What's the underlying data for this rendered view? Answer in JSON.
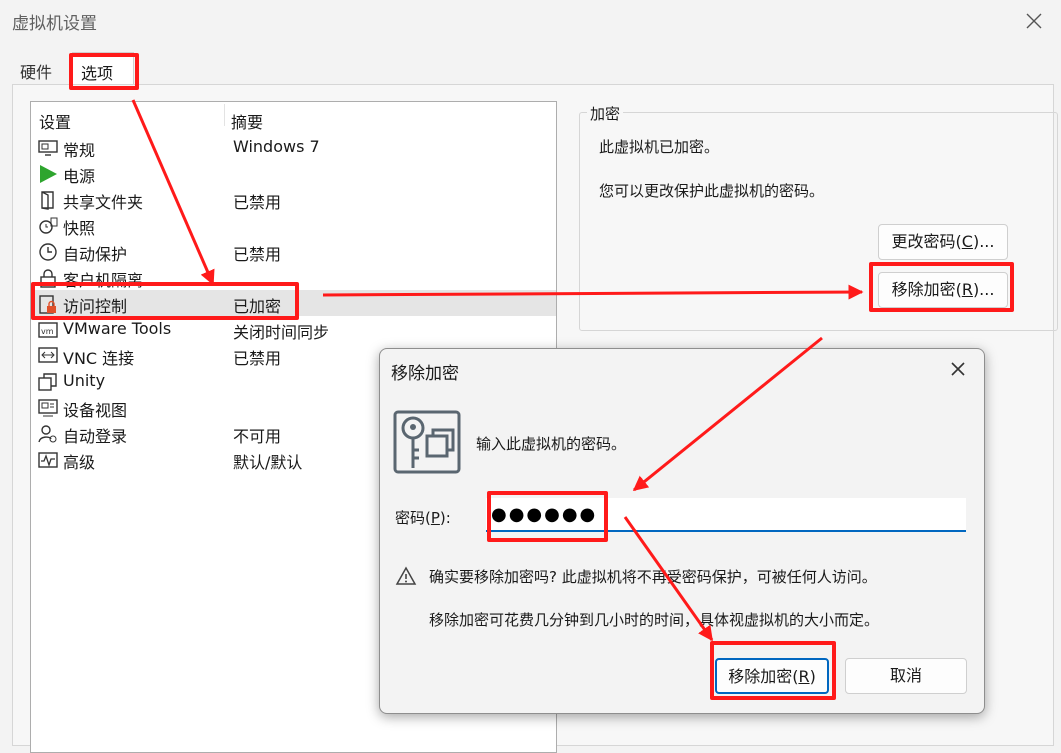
{
  "window": {
    "title": "虚拟机设置"
  },
  "tabs": {
    "hardware": "硬件",
    "options": "选项"
  },
  "list": {
    "header_setting": "设置",
    "header_summary": "摘要",
    "rows": [
      {
        "name": "常规",
        "summary": "Windows 7",
        "icon": "monitor-icon"
      },
      {
        "name": "电源",
        "summary": "",
        "icon": "power-play-icon"
      },
      {
        "name": "共享文件夹",
        "summary": "已禁用",
        "icon": "shared-folder-icon"
      },
      {
        "name": "快照",
        "summary": "",
        "icon": "snapshot-icon"
      },
      {
        "name": "自动保护",
        "summary": "已禁用",
        "icon": "clock-icon"
      },
      {
        "name": "客户机隔离",
        "summary": "",
        "icon": "lock-icon"
      },
      {
        "name": "访问控制",
        "summary": "已加密",
        "icon": "access-lock-icon"
      },
      {
        "name": "VMware Tools",
        "summary": "关闭时间同步",
        "icon": "vm-tools-icon"
      },
      {
        "name": "VNC 连接",
        "summary": "已禁用",
        "icon": "vnc-icon"
      },
      {
        "name": "Unity",
        "summary": "",
        "icon": "unity-icon"
      },
      {
        "name": "设备视图",
        "summary": "",
        "icon": "device-view-icon"
      },
      {
        "name": "自动登录",
        "summary": "不可用",
        "icon": "autologin-icon"
      },
      {
        "name": "高级",
        "summary": "默认/默认",
        "icon": "advanced-icon"
      }
    ]
  },
  "encryption": {
    "legend": "加密",
    "status": "此虚拟机已加密。",
    "hint": "您可以更改保护此虚拟机的密码。",
    "change_btn_pre": "更改密码(",
    "change_btn_key": "C",
    "change_btn_post": ")...",
    "remove_btn_pre": "移除加密(",
    "remove_btn_key": "R",
    "remove_btn_post": ")..."
  },
  "dialog": {
    "title": "移除加密",
    "prompt": "输入此虚拟机的密码。",
    "password_label_pre": "密码(",
    "password_label_key": "P",
    "password_label_post": "):",
    "password_value": "●●●●●●",
    "warning_line1": "确实要移除加密吗? 此虚拟机将不再受密码保护，可被任何人访问。",
    "warning_line2": "移除加密可花费几分钟到几小时的时间，具体视虚拟机的大小而定。",
    "ok_pre": "移除加密(",
    "ok_key": "R",
    "ok_post": ")",
    "cancel": "取消"
  },
  "colors": {
    "highlight": "#ff1a1a",
    "accent": "#0067c0",
    "power_green": "#2ea52e"
  }
}
